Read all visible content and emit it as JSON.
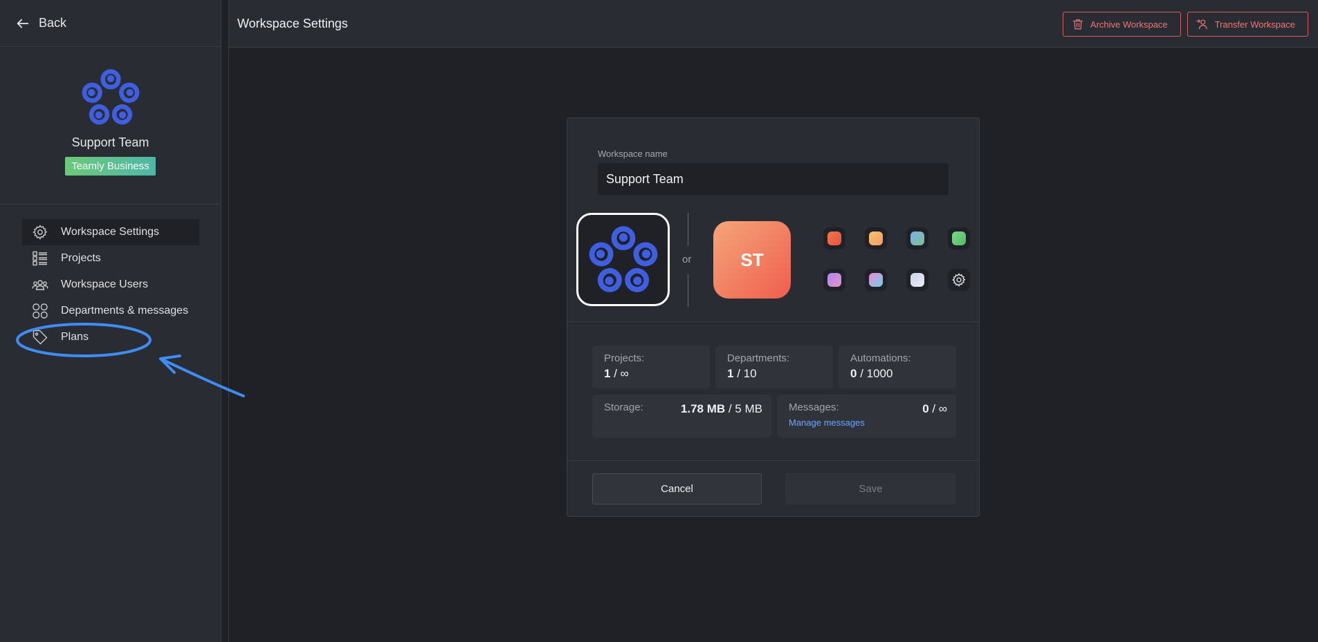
{
  "sidebar": {
    "back_label": "Back",
    "workspace_name": "Support Team",
    "plan_badge": "Teamly Business",
    "items": [
      {
        "label": "Workspace Settings",
        "icon": "gear-icon",
        "active": true
      },
      {
        "label": "Projects",
        "icon": "list-icon",
        "active": false
      },
      {
        "label": "Workspace Users",
        "icon": "users-icon",
        "active": false
      },
      {
        "label": "Departments & messages",
        "icon": "grid-icon",
        "active": false
      },
      {
        "label": "Plans",
        "icon": "tag-icon",
        "active": false
      }
    ]
  },
  "header": {
    "title": "Workspace Settings",
    "archive_label": "Archive Workspace",
    "transfer_label": "Transfer Workspace"
  },
  "form": {
    "name_label": "Workspace name",
    "name_value": "Support Team",
    "or_label": "or",
    "initials": "ST",
    "swatches": [
      {
        "name": "red-orange",
        "from": "#f0764e",
        "to": "#e8533d"
      },
      {
        "name": "peach",
        "from": "#f8c46a",
        "to": "#f19a66"
      },
      {
        "name": "blue-green",
        "from": "#7fb0f0",
        "to": "#78c28c"
      },
      {
        "name": "green",
        "from": "#84d98c",
        "to": "#4fb866"
      },
      {
        "name": "violet-pink",
        "from": "#a88af0",
        "to": "#e892c7"
      },
      {
        "name": "rainbow",
        "from": "#f08ad0",
        "to": "#6ad0f0"
      },
      {
        "name": "silver",
        "from": "#c9d2e8",
        "to": "#e8ecf5"
      }
    ],
    "stats": {
      "projects": {
        "label": "Projects:",
        "value_bold": "1",
        "value_rest": " / ∞"
      },
      "departments": {
        "label": "Departments:",
        "value_bold": "1",
        "value_rest": " / 10"
      },
      "automations": {
        "label": "Automations:",
        "value_bold": "0",
        "value_rest": " / 1000"
      },
      "storage": {
        "label": "Storage:",
        "value_bold": "1.78 MB",
        "value_rest": " / 5 MB"
      },
      "messages": {
        "label": "Messages:",
        "value_bold": "0",
        "value_rest": " / ∞",
        "link": "Manage messages"
      }
    },
    "cancel_label": "Cancel",
    "save_label": "Save"
  },
  "colors": {
    "accent_blue": "#3f5fe0",
    "danger": "#ee7777",
    "annotation": "#3f8cf2"
  }
}
